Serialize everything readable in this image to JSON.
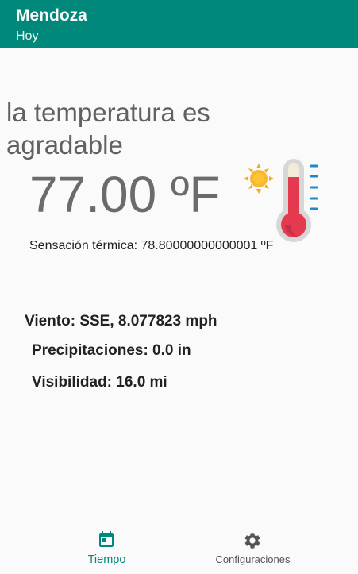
{
  "appbar": {
    "title": "Mendoza",
    "subtitle": "Hoy"
  },
  "weather": {
    "condition": "la temperatura es agradable",
    "temperature": "77.00 ºF",
    "feels_like": "Sensación térmica: 78.80000000000001 ºF",
    "wind": "Viento: SSE, 8.077823 mph",
    "precipitation": "Precipitaciones: 0.0 in",
    "visibility": "Visibilidad: 16.0 mi"
  },
  "icons": {
    "weather": "sun-thermometer-icon"
  },
  "nav": {
    "tiempo": "Tiempo",
    "config": "Configuraciones"
  },
  "colors": {
    "primary": "#00897b",
    "thermometer": "#e53950",
    "sun": "#f5a623"
  }
}
